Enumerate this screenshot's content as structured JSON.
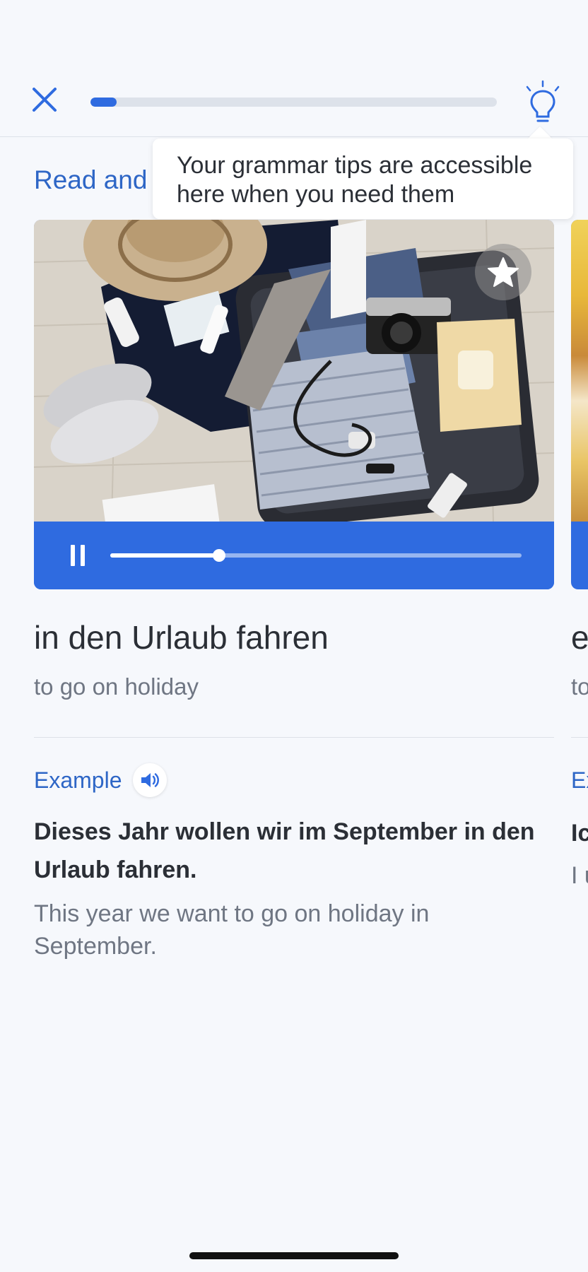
{
  "header": {
    "close_icon": "close-icon",
    "tips_icon": "lightbulb-icon",
    "progress_fraction": 0.065,
    "accent_color": "#2f6be0"
  },
  "section": {
    "title": "Read and"
  },
  "tooltip": {
    "text": "Your grammar tips are accessible here when you need them"
  },
  "card": {
    "photo_description_icon": "suitcase-photo",
    "star_icon": "star-icon",
    "audio": {
      "state": "playing",
      "position_fraction": 0.265
    }
  },
  "word": {
    "german": "in den Urlaub fahren",
    "english": "to go on holiday"
  },
  "example": {
    "label": "Example",
    "speaker_icon": "speaker-icon",
    "german": "Dieses Jahr wollen wir im September in den Urlaub fahren.",
    "english": "This year we want to go on holiday in September."
  },
  "next_card_peek": {
    "word_start": "e",
    "translation_start": "to",
    "example_label_start": "Ex",
    "example_de_start": "Ic",
    "example_en_start": "I u"
  }
}
